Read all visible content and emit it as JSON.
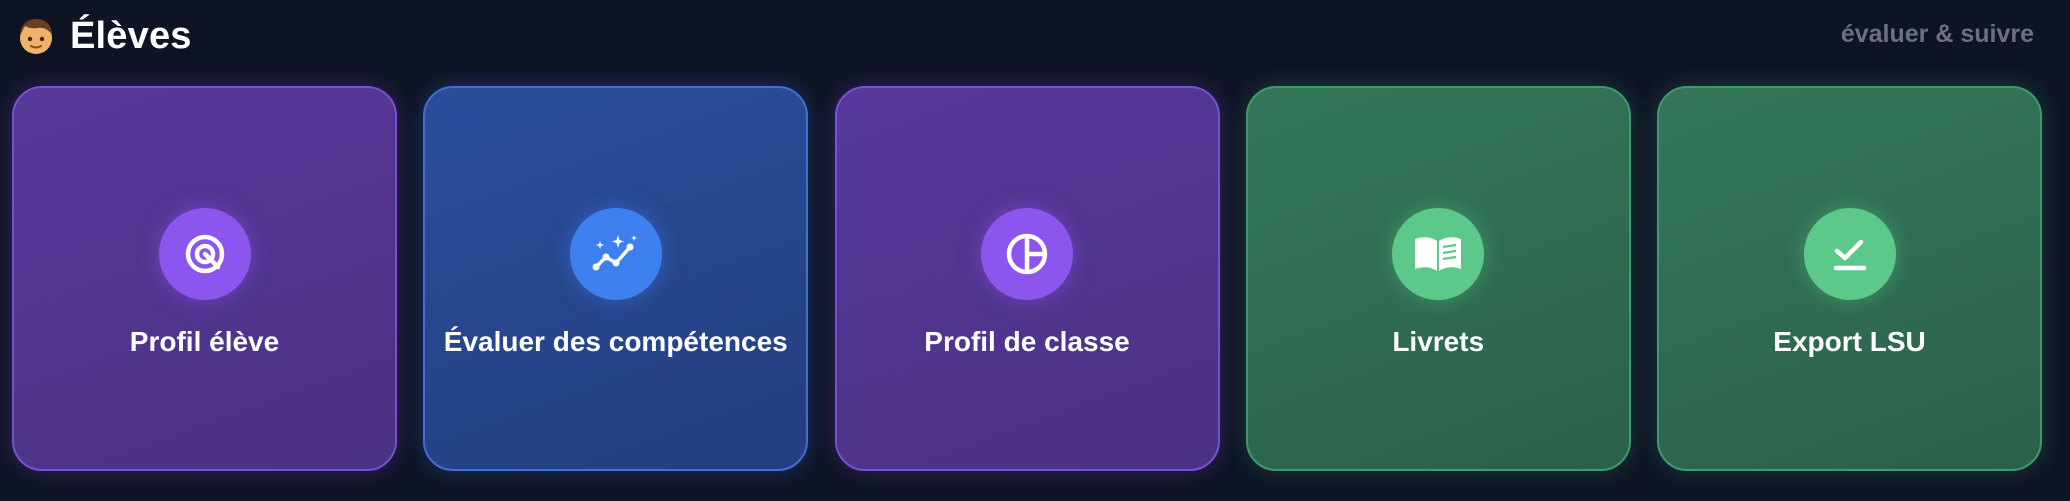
{
  "header": {
    "title": "Élèves",
    "emoji": "boy-face-emoji",
    "subtitle": "évaluer & suivre"
  },
  "cards": [
    {
      "label": "Profil élève",
      "icon": "target-icon",
      "theme": "purple"
    },
    {
      "label": "Évaluer des compétences",
      "icon": "sparkle-line-chart-icon",
      "theme": "blue"
    },
    {
      "label": "Profil de classe",
      "icon": "pie-chart-icon",
      "theme": "purple"
    },
    {
      "label": "Livrets",
      "icon": "open-book-icon",
      "theme": "green"
    },
    {
      "label": "Export LSU",
      "icon": "checkmark-underline-icon",
      "theme": "green"
    }
  ],
  "colors": {
    "background": "#0f1425",
    "purple_accent": "#8c55ee",
    "blue_accent": "#3f80f0",
    "green_accent": "#5cc98a",
    "subtitle_gray": "#6c7080"
  }
}
